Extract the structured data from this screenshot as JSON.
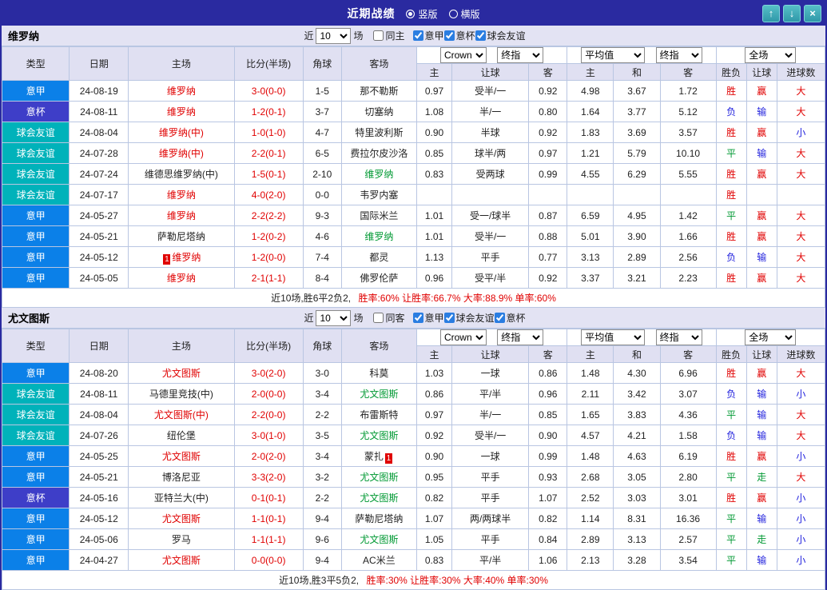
{
  "titlebar": {
    "title": "近期战绩",
    "layout_options": [
      {
        "label": "竖版",
        "selected": true
      },
      {
        "label": "横版",
        "selected": false
      }
    ],
    "buttons": {
      "up": "↑",
      "down": "↓",
      "close": "×"
    }
  },
  "labels": {
    "near": "近",
    "games": "场"
  },
  "colors": {
    "league": {
      "意甲": "#0b80e8",
      "意杯": "#3e3ec8",
      "球会友谊": "#00b2ba"
    },
    "team": {
      "r": "#e00000",
      "g": "#009933",
      "b": "#222222"
    },
    "mark": {
      "胜": "#e00000",
      "负": "#2222dd",
      "平": "#009933",
      "赢": "#e00000",
      "输": "#2222dd",
      "走": "#009933",
      "大": "#e00000",
      "小": "#2222dd"
    }
  },
  "header": {
    "cols": [
      "类型",
      "日期",
      "主场",
      "比分(半场)",
      "角球",
      "客场"
    ],
    "sub": [
      "主",
      "让球",
      "客",
      "主",
      "和",
      "客",
      "胜负",
      "让球",
      "进球数"
    ],
    "selects": {
      "bookmaker": "Crown",
      "final1": "终指",
      "average": "平均值",
      "final2": "终指",
      "scope": "全场"
    }
  },
  "sections": [
    {
      "team": "维罗纳",
      "filter": {
        "count": "10",
        "same": {
          "label": "同主",
          "checked": false
        },
        "leagues": [
          {
            "label": "意甲",
            "checked": true
          },
          {
            "label": "意杯",
            "checked": true
          },
          {
            "label": "球会友谊",
            "checked": true
          }
        ]
      },
      "rows": [
        {
          "league": "意甲",
          "date": "24-08-19",
          "home": {
            "n": "维罗纳",
            "c": "r"
          },
          "score": "3-0(0-0)",
          "corner": "1-5",
          "away": {
            "n": "那不勒斯",
            "c": "b"
          },
          "o1": "0.97",
          "hc": "受半/一",
          "o2": "0.92",
          "a1": "4.98",
          "a2": "3.67",
          "a3": "1.72",
          "res": "胜",
          "sp": "赢",
          "gl": "大"
        },
        {
          "league": "意杯",
          "date": "24-08-11",
          "home": {
            "n": "维罗纳",
            "c": "r"
          },
          "score": "1-2(0-1)",
          "corner": "3-7",
          "away": {
            "n": "切塞纳",
            "c": "b"
          },
          "o1": "1.08",
          "hc": "半/一",
          "o2": "0.80",
          "a1": "1.64",
          "a2": "3.77",
          "a3": "5.12",
          "res": "负",
          "sp": "输",
          "gl": "大"
        },
        {
          "league": "球会友谊",
          "date": "24-08-04",
          "home": {
            "n": "维罗纳(中)",
            "c": "r"
          },
          "score": "1-0(1-0)",
          "corner": "4-7",
          "away": {
            "n": "特里波利斯",
            "c": "b"
          },
          "o1": "0.90",
          "hc": "半球",
          "o2": "0.92",
          "a1": "1.83",
          "a2": "3.69",
          "a3": "3.57",
          "res": "胜",
          "sp": "赢",
          "gl": "小"
        },
        {
          "league": "球会友谊",
          "date": "24-07-28",
          "home": {
            "n": "维罗纳(中)",
            "c": "r"
          },
          "score": "2-2(0-1)",
          "corner": "6-5",
          "away": {
            "n": "费拉尔皮沙洛",
            "c": "b"
          },
          "o1": "0.85",
          "hc": "球半/两",
          "o2": "0.97",
          "a1": "1.21",
          "a2": "5.79",
          "a3": "10.10",
          "res": "平",
          "sp": "输",
          "gl": "大"
        },
        {
          "league": "球会友谊",
          "date": "24-07-24",
          "home": {
            "n": "维德思维罗纳(中)",
            "c": "b"
          },
          "score": "1-5(0-1)",
          "corner": "2-10",
          "away": {
            "n": "维罗纳",
            "c": "g"
          },
          "o1": "0.83",
          "hc": "受两球",
          "o2": "0.99",
          "a1": "4.55",
          "a2": "6.29",
          "a3": "5.55",
          "res": "胜",
          "sp": "赢",
          "gl": "大"
        },
        {
          "league": "球会友谊",
          "date": "24-07-17",
          "home": {
            "n": "维罗纳",
            "c": "r"
          },
          "score": "4-0(2-0)",
          "corner": "0-0",
          "away": {
            "n": "韦罗内塞",
            "c": "b"
          },
          "o1": "",
          "hc": "",
          "o2": "",
          "a1": "",
          "a2": "",
          "a3": "",
          "res": "胜",
          "sp": "",
          "gl": ""
        },
        {
          "league": "意甲",
          "date": "24-05-27",
          "home": {
            "n": "维罗纳",
            "c": "r"
          },
          "score": "2-2(2-2)",
          "corner": "9-3",
          "away": {
            "n": "国际米兰",
            "c": "b"
          },
          "o1": "1.01",
          "hc": "受一/球半",
          "o2": "0.87",
          "a1": "6.59",
          "a2": "4.95",
          "a3": "1.42",
          "res": "平",
          "sp": "赢",
          "gl": "大"
        },
        {
          "league": "意甲",
          "date": "24-05-21",
          "home": {
            "n": "萨勒尼塔纳",
            "c": "b"
          },
          "score": "1-2(0-2)",
          "corner": "4-6",
          "away": {
            "n": "维罗纳",
            "c": "g"
          },
          "o1": "1.01",
          "hc": "受半/一",
          "o2": "0.88",
          "a1": "5.01",
          "a2": "3.90",
          "a3": "1.66",
          "res": "胜",
          "sp": "赢",
          "gl": "大"
        },
        {
          "league": "意甲",
          "date": "24-05-12",
          "home": {
            "n": "维罗纳",
            "c": "r",
            "card": "1"
          },
          "score": "1-2(0-0)",
          "corner": "7-4",
          "away": {
            "n": "都灵",
            "c": "b"
          },
          "o1": "1.13",
          "hc": "平手",
          "o2": "0.77",
          "a1": "3.13",
          "a2": "2.89",
          "a3": "2.56",
          "res": "负",
          "sp": "输",
          "gl": "大"
        },
        {
          "league": "意甲",
          "date": "24-05-05",
          "home": {
            "n": "维罗纳",
            "c": "r"
          },
          "score": "2-1(1-1)",
          "corner": "8-4",
          "away": {
            "n": "佛罗伦萨",
            "c": "b"
          },
          "o1": "0.96",
          "hc": "受平/半",
          "o2": "0.92",
          "a1": "3.37",
          "a2": "3.21",
          "a3": "2.23",
          "res": "胜",
          "sp": "赢",
          "gl": "大"
        }
      ],
      "summary": {
        "record": "近10场,胜6平2负2,",
        "stats": "胜率:60% 让胜率:66.7% 大率:88.9% 单率:60%"
      }
    },
    {
      "team": "尤文图斯",
      "filter": {
        "count": "10",
        "same": {
          "label": "同客",
          "checked": false
        },
        "leagues": [
          {
            "label": "意甲",
            "checked": true
          },
          {
            "label": "球会友谊",
            "checked": true
          },
          {
            "label": "意杯",
            "checked": true
          }
        ]
      },
      "rows": [
        {
          "league": "意甲",
          "date": "24-08-20",
          "home": {
            "n": "尤文图斯",
            "c": "r"
          },
          "score": "3-0(2-0)",
          "corner": "3-0",
          "away": {
            "n": "科莫",
            "c": "b"
          },
          "o1": "1.03",
          "hc": "一球",
          "o2": "0.86",
          "a1": "1.48",
          "a2": "4.30",
          "a3": "6.96",
          "res": "胜",
          "sp": "赢",
          "gl": "大"
        },
        {
          "league": "球会友谊",
          "date": "24-08-11",
          "home": {
            "n": "马德里竞技(中)",
            "c": "b"
          },
          "score": "2-0(0-0)",
          "corner": "3-4",
          "away": {
            "n": "尤文图斯",
            "c": "g"
          },
          "o1": "0.86",
          "hc": "平/半",
          "o2": "0.96",
          "a1": "2.11",
          "a2": "3.42",
          "a3": "3.07",
          "res": "负",
          "sp": "输",
          "gl": "小"
        },
        {
          "league": "球会友谊",
          "date": "24-08-04",
          "home": {
            "n": "尤文图斯(中)",
            "c": "r"
          },
          "score": "2-2(0-0)",
          "corner": "2-2",
          "away": {
            "n": "布雷斯特",
            "c": "b"
          },
          "o1": "0.97",
          "hc": "半/一",
          "o2": "0.85",
          "a1": "1.65",
          "a2": "3.83",
          "a3": "4.36",
          "res": "平",
          "sp": "输",
          "gl": "大"
        },
        {
          "league": "球会友谊",
          "date": "24-07-26",
          "home": {
            "n": "纽伦堡",
            "c": "b"
          },
          "score": "3-0(1-0)",
          "corner": "3-5",
          "away": {
            "n": "尤文图斯",
            "c": "g"
          },
          "o1": "0.92",
          "hc": "受半/一",
          "o2": "0.90",
          "a1": "4.57",
          "a2": "4.21",
          "a3": "1.58",
          "res": "负",
          "sp": "输",
          "gl": "大"
        },
        {
          "league": "意甲",
          "date": "24-05-25",
          "home": {
            "n": "尤文图斯",
            "c": "r"
          },
          "score": "2-0(2-0)",
          "corner": "3-4",
          "away": {
            "n": "蒙扎",
            "c": "b",
            "card": "1"
          },
          "o1": "0.90",
          "hc": "一球",
          "o2": "0.99",
          "a1": "1.48",
          "a2": "4.63",
          "a3": "6.19",
          "res": "胜",
          "sp": "赢",
          "gl": "小"
        },
        {
          "league": "意甲",
          "date": "24-05-21",
          "home": {
            "n": "博洛尼亚",
            "c": "b"
          },
          "score": "3-3(2-0)",
          "corner": "3-2",
          "away": {
            "n": "尤文图斯",
            "c": "g"
          },
          "o1": "0.95",
          "hc": "平手",
          "o2": "0.93",
          "a1": "2.68",
          "a2": "3.05",
          "a3": "2.80",
          "res": "平",
          "sp": "走",
          "gl": "大"
        },
        {
          "league": "意杯",
          "date": "24-05-16",
          "home": {
            "n": "亚特兰大(中)",
            "c": "b"
          },
          "score": "0-1(0-1)",
          "corner": "2-2",
          "away": {
            "n": "尤文图斯",
            "c": "g"
          },
          "o1": "0.82",
          "hc": "平手",
          "o2": "1.07",
          "a1": "2.52",
          "a2": "3.03",
          "a3": "3.01",
          "res": "胜",
          "sp": "赢",
          "gl": "小"
        },
        {
          "league": "意甲",
          "date": "24-05-12",
          "home": {
            "n": "尤文图斯",
            "c": "r"
          },
          "score": "1-1(0-1)",
          "corner": "9-4",
          "away": {
            "n": "萨勒尼塔纳",
            "c": "b"
          },
          "o1": "1.07",
          "hc": "两/两球半",
          "o2": "0.82",
          "a1": "1.14",
          "a2": "8.31",
          "a3": "16.36",
          "res": "平",
          "sp": "输",
          "gl": "小"
        },
        {
          "league": "意甲",
          "date": "24-05-06",
          "home": {
            "n": "罗马",
            "c": "b"
          },
          "score": "1-1(1-1)",
          "corner": "9-6",
          "away": {
            "n": "尤文图斯",
            "c": "g"
          },
          "o1": "1.05",
          "hc": "平手",
          "o2": "0.84",
          "a1": "2.89",
          "a2": "3.13",
          "a3": "2.57",
          "res": "平",
          "sp": "走",
          "gl": "小"
        },
        {
          "league": "意甲",
          "date": "24-04-27",
          "home": {
            "n": "尤文图斯",
            "c": "r"
          },
          "score": "0-0(0-0)",
          "corner": "9-4",
          "away": {
            "n": "AC米兰",
            "c": "b"
          },
          "o1": "0.83",
          "hc": "平/半",
          "o2": "1.06",
          "a1": "2.13",
          "a2": "3.28",
          "a3": "3.54",
          "res": "平",
          "sp": "输",
          "gl": "小"
        }
      ],
      "summary": {
        "record": "近10场,胜3平5负2,",
        "stats": "胜率:30% 让胜率:30% 大率:40% 单率:30%"
      }
    }
  ]
}
